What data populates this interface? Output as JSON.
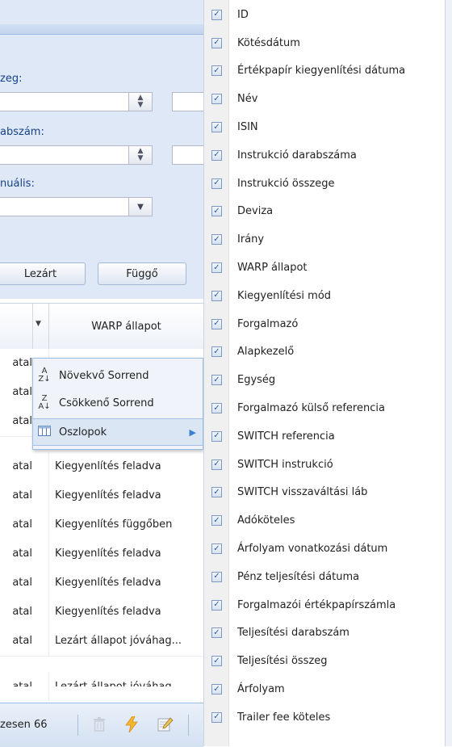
{
  "filters": {
    "amount_label": "zeg:",
    "quantity_label": "abszám:",
    "manual_label": "nuális:",
    "buttons": [
      "Lezárt",
      "Függő"
    ]
  },
  "grid": {
    "header": "WARP állapot",
    "rows": [
      {
        "c1": "atal",
        "c2": ""
      },
      {
        "c1": "atal",
        "c2": ""
      },
      {
        "c1": "atal",
        "c2": ""
      },
      {
        "c1": "atal",
        "c2": "Kiegyenlítés feladva"
      },
      {
        "c1": "atal",
        "c2": "Kiegyenlítés feladva"
      },
      {
        "c1": "atal",
        "c2": "Kiegyenlítés függőben"
      },
      {
        "c1": "atal",
        "c2": "Kiegyenlítés feladva"
      },
      {
        "c1": "atal",
        "c2": "Kiegyenlítés feladva"
      },
      {
        "c1": "atal",
        "c2": "Kiegyenlítés feladva"
      },
      {
        "c1": "atal",
        "c2": "Lezárt állapot jóváhag..."
      },
      {
        "c1": "atal",
        "c2": "Lezárt állapot jóváhag..."
      }
    ]
  },
  "header_menu": {
    "sort_asc": "Növekvő Sorrend",
    "sort_desc": "Csökkenő Sorrend",
    "columns": "Oszlopok"
  },
  "toolbar": {
    "total_text": "zesen 66"
  },
  "column_menu": {
    "items": [
      {
        "label": "ID",
        "checked": true
      },
      {
        "label": "Kötésdátum",
        "checked": true
      },
      {
        "label": "Értékpapír kiegyenlítési dátuma",
        "checked": true
      },
      {
        "label": "Név",
        "checked": true
      },
      {
        "label": "ISIN",
        "checked": true
      },
      {
        "label": "Instrukció darabszáma",
        "checked": true
      },
      {
        "label": "Instrukció összege",
        "checked": true
      },
      {
        "label": "Deviza",
        "checked": true
      },
      {
        "label": "Irány",
        "checked": true
      },
      {
        "label": "WARP állapot",
        "checked": true
      },
      {
        "label": "Kiegyenlítési mód",
        "checked": true
      },
      {
        "label": "Forgalmazó",
        "checked": true
      },
      {
        "label": "Alapkezelő",
        "checked": true
      },
      {
        "label": "Egység",
        "checked": true
      },
      {
        "label": "Forgalmazó külső referencia",
        "checked": true
      },
      {
        "label": "SWITCH referencia",
        "checked": true
      },
      {
        "label": "SWITCH instrukció",
        "checked": true
      },
      {
        "label": "SWITCH visszaváltási láb",
        "checked": true
      },
      {
        "label": "Adóköteles",
        "checked": true
      },
      {
        "label": "Árfolyam vonatkozási dátum",
        "checked": true
      },
      {
        "label": "Pénz teljesítési dátuma",
        "checked": true
      },
      {
        "label": "Forgalmazói értékpapírszámla",
        "checked": true
      },
      {
        "label": "Teljesítési darabszám",
        "checked": true
      },
      {
        "label": "Teljesítési összeg",
        "checked": true
      },
      {
        "label": "Árfolyam",
        "checked": true
      },
      {
        "label": "Trailer fee köteles",
        "checked": true
      }
    ]
  }
}
